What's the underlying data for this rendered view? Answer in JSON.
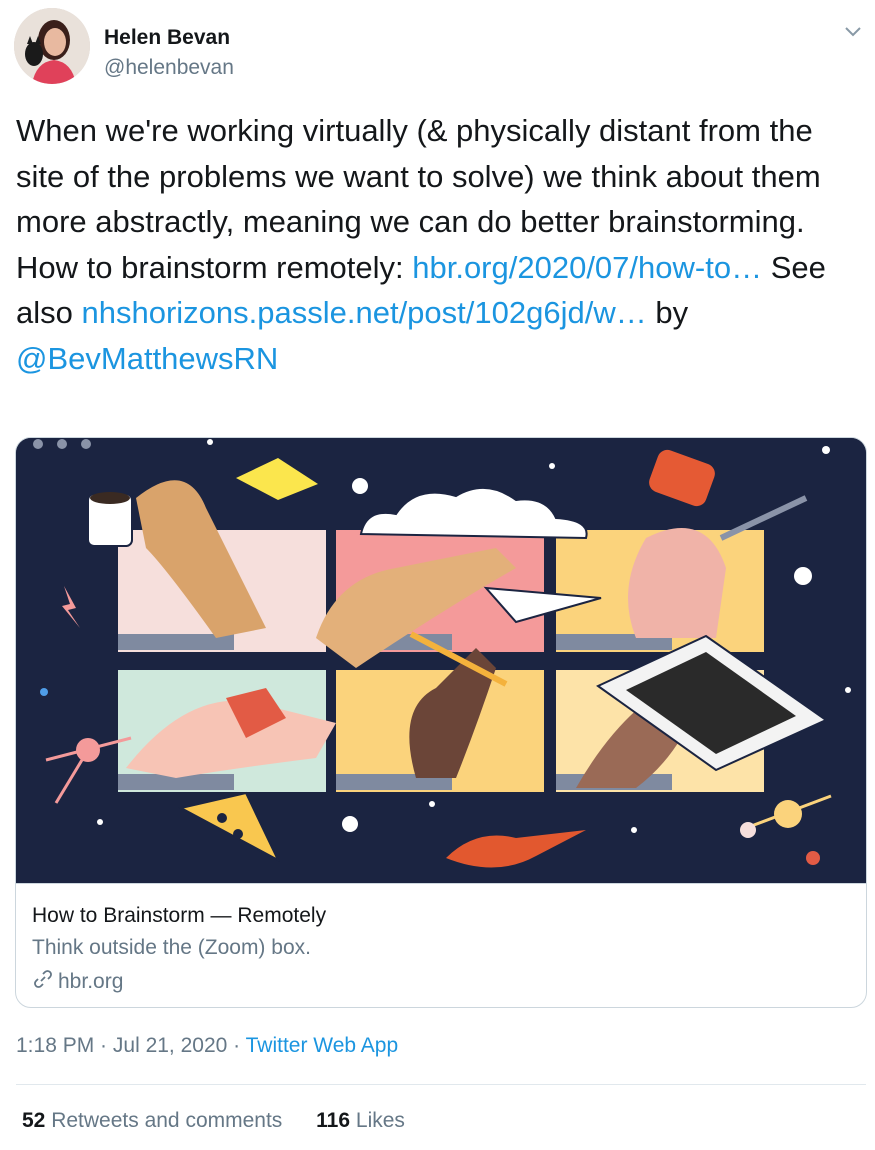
{
  "author": {
    "name": "Helen Bevan",
    "handle": "@helenbevan"
  },
  "tweet": {
    "text_part1": "When we're working virtually (& physically distant from the site of the problems we want to solve) we think about them more abstractly, meaning we can do better brainstorming. How to brainstorm remotely: ",
    "link1": "hbr.org/2020/07/how-to…",
    "text_part2": " See also ",
    "link2": "nhshorizons.passle.net/post/102g6jd/w…",
    "text_part3": " by ",
    "mention": "@BevMatthewsRN"
  },
  "card": {
    "title": "How to Brainstorm — Remotely",
    "description": "Think outside the (Zoom) box.",
    "domain": "hbr.org",
    "domain_icon": "link-icon"
  },
  "meta": {
    "time": "1:18 PM",
    "separator": " · ",
    "date": "Jul 21, 2020",
    "source": "Twitter Web App"
  },
  "stats": {
    "retweets_count": "52",
    "retweets_label": "Retweets and comments",
    "likes_count": "116",
    "likes_label": "Likes"
  },
  "colors": {
    "link": "#1b95e0",
    "secondary": "#657786",
    "illustration_bg": "#1b2441"
  }
}
